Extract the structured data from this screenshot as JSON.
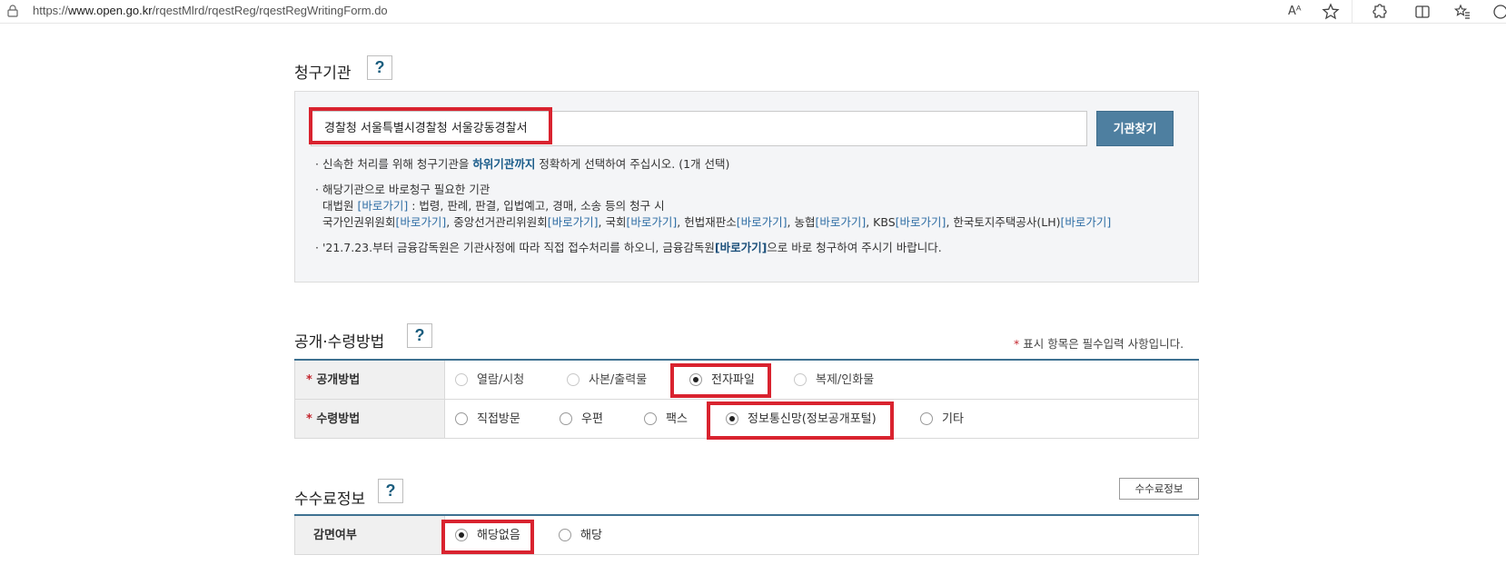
{
  "browser": {
    "url_prefix": "https://",
    "url_host": "www.open.go.kr",
    "url_path": "/rqestMlrd/rqestReg/rqestRegWritingForm.do",
    "read_aloud": "Aᴬ"
  },
  "org_section": {
    "title": "청구기관",
    "help": "?",
    "input_value": "경찰청 서울특별시경찰청 서울강동경찰서",
    "find_button": "기관찾기",
    "note1_pre": "· 신속한 처리를 위해 청구기관을 ",
    "note1_hl": "하위기관까지",
    "note1_post": " 정확하게 선택하여 주십시오. (1개 선택)",
    "note2_head": "· 해당기관으로 바로청구 필요한 기관",
    "note2_l1_a": "대법원 ",
    "note2_l1_link": "[바로가기]",
    "note2_l1_b": " : 법령, 판례, 판결, 입법예고, 경매, 소송 등의 청구 시",
    "note2_l2": [
      {
        "name": "국가인권위원회",
        "link": "[바로가기]",
        "sep": ", "
      },
      {
        "name": "중앙선거관리위원회",
        "link": "[바로가기]",
        "sep": ", "
      },
      {
        "name": "국회",
        "link": "[바로가기]",
        "sep": ", "
      },
      {
        "name": "헌법재판소",
        "link": "[바로가기]",
        "sep": ", "
      },
      {
        "name": "농협",
        "link": "[바로가기]",
        "sep": ", "
      },
      {
        "name": "KBS",
        "link": "[바로가기]",
        "sep": ", "
      },
      {
        "name": "한국토지주택공사(LH)",
        "link": "[바로가기]",
        "sep": ""
      }
    ],
    "note3_pre": "· '21.7.23.부터 금융감독원은 기관사정에 따라 직접 접수처리를 하오니, 금융감독원",
    "note3_link": "[바로가기]",
    "note3_post": "으로 바로 청구하여 주시기 바랍니다."
  },
  "method_section": {
    "title": "공개·수령방법",
    "help": "?",
    "required_star": "*",
    "required_note": " 표시 항목은 필수입력 사항입니다.",
    "disclosure": {
      "label": "공개방법",
      "options": [
        "열람/시청",
        "사본/출력물",
        "전자파일",
        "복제/인화물"
      ],
      "selected": "전자파일"
    },
    "receipt": {
      "label": "수령방법",
      "options": [
        "직접방문",
        "우편",
        "팩스",
        "정보통신망(정보공개포털)",
        "기타"
      ],
      "selected": "정보통신망(정보공개포털)"
    }
  },
  "fee_section": {
    "title": "수수료정보",
    "help": "?",
    "fee_button": "수수료정보",
    "exemption": {
      "label": "감면여부",
      "options": [
        "해당없음",
        "해당"
      ],
      "selected": "해당없음"
    }
  }
}
